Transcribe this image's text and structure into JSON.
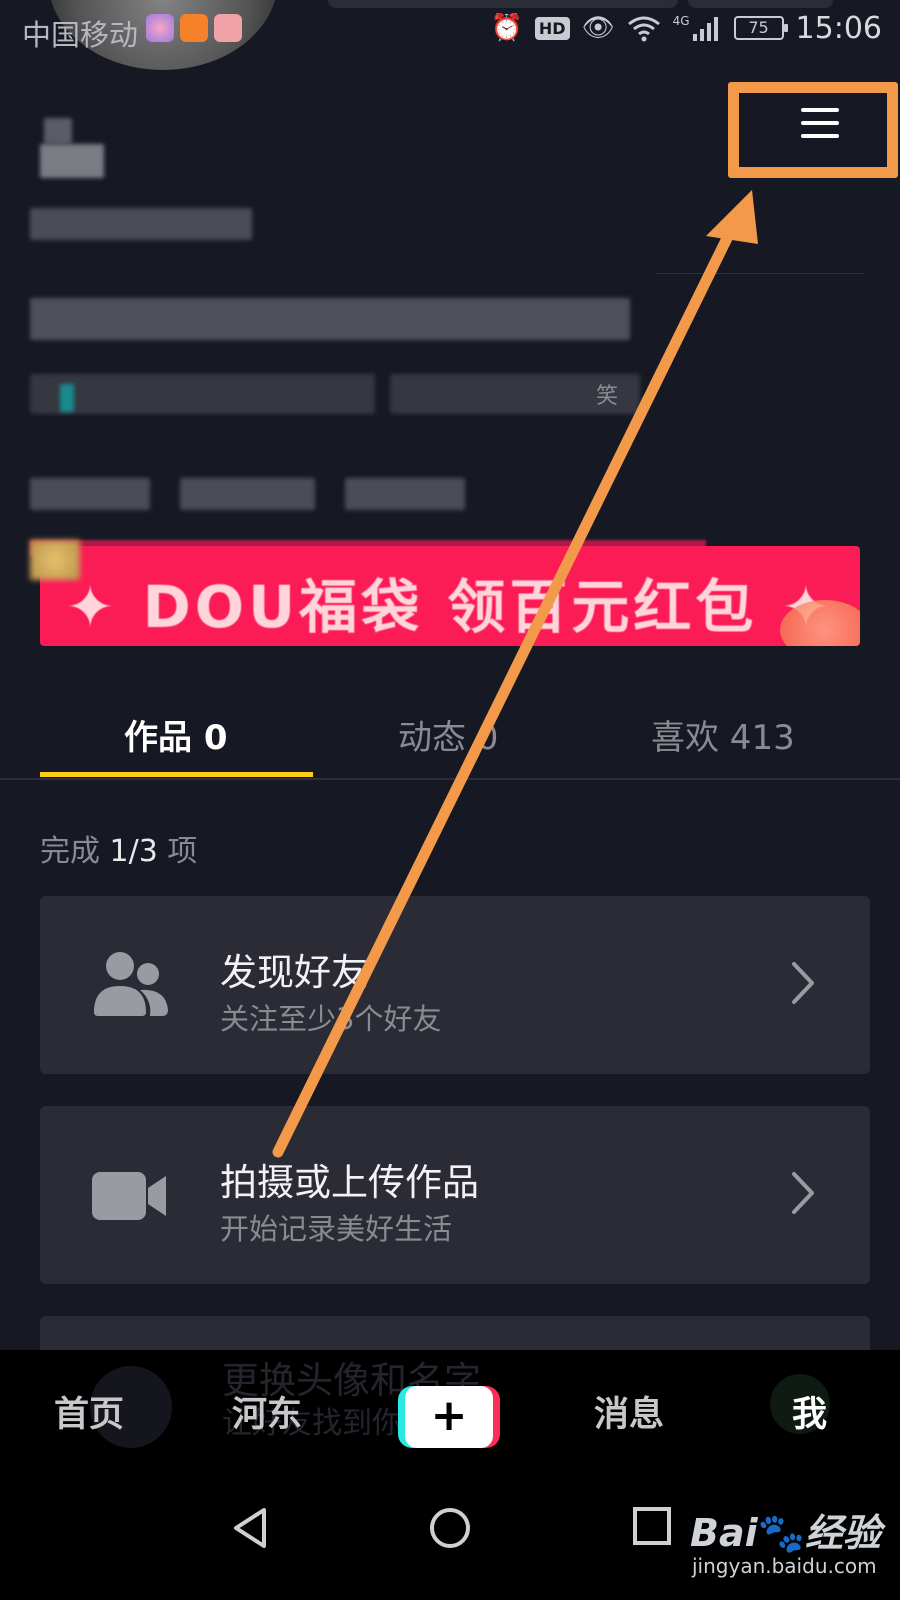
{
  "status_bar": {
    "carrier": "中国移动",
    "hd": "HD",
    "network": "4G",
    "battery": "75",
    "time": "15:06"
  },
  "banner": {
    "text": "✦ DOU福袋 领百元红包 ✦"
  },
  "partial_text": "笑",
  "tabs": [
    {
      "label": "作品 0",
      "active": true
    },
    {
      "label": "动态 0",
      "active": false
    },
    {
      "label": "喜欢 413",
      "active": false
    }
  ],
  "tasks": {
    "progress_prefix": "完成",
    "progress_value": "1/3",
    "progress_suffix": "项",
    "items": [
      {
        "title": "发现好友",
        "subtitle": "关注至少3个好友",
        "icon": "users-icon"
      },
      {
        "title": "拍摄或上传作品",
        "subtitle": "开始记录美好生活",
        "icon": "video-camera-icon"
      },
      {
        "title": "更换头像和名字",
        "subtitle": "让好友找到你",
        "icon": "avatar-icon"
      }
    ]
  },
  "bottom_nav": {
    "home": "首页",
    "local": "河东",
    "plus": "+",
    "messages": "消息",
    "me": "我"
  },
  "watermark": {
    "brand_left": "Bai",
    "brand_right": "经验",
    "url": "jingyan.baidu.com"
  },
  "colors": {
    "background": "#161823",
    "accent_yellow": "#face15",
    "banner_red": "#fb1b55",
    "highlight_orange": "#f39a4a",
    "card": "#2a2b35"
  }
}
